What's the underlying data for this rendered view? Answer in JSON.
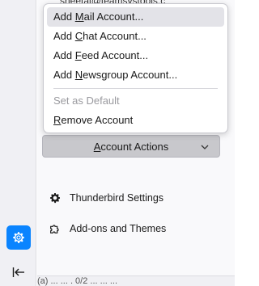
{
  "account": {
    "email_partial": "sheetal@teamsystools.c"
  },
  "menu": {
    "items": [
      {
        "pre": "Add ",
        "u": "M",
        "post": "ail Account..."
      },
      {
        "pre": "Add ",
        "u": "C",
        "post": "hat Account..."
      },
      {
        "pre": "Add ",
        "u": "F",
        "post": "eed Account..."
      },
      {
        "pre": "Add ",
        "u": "N",
        "post": "ewsgroup Account..."
      }
    ],
    "default_label": "Set as Default",
    "remove": {
      "u": "R",
      "post": "emove Account"
    }
  },
  "account_actions": {
    "u": "A",
    "post": "ccount Actions"
  },
  "sidebar": {
    "settings_label": "Thunderbird Settings",
    "addons_label": "Add-ons and Themes"
  },
  "status_partial": "(a)   ...  ...  . 0/2  ... ... ...",
  "icons": {
    "settings": "gear-icon",
    "addons": "puzzle-icon",
    "collapse": "collapse-left-icon",
    "chevron": "chevron-down-icon"
  },
  "colors": {
    "accent": "#0a84ff",
    "hover": "#e3e3e8",
    "button_bg": "#c8c8cc"
  }
}
